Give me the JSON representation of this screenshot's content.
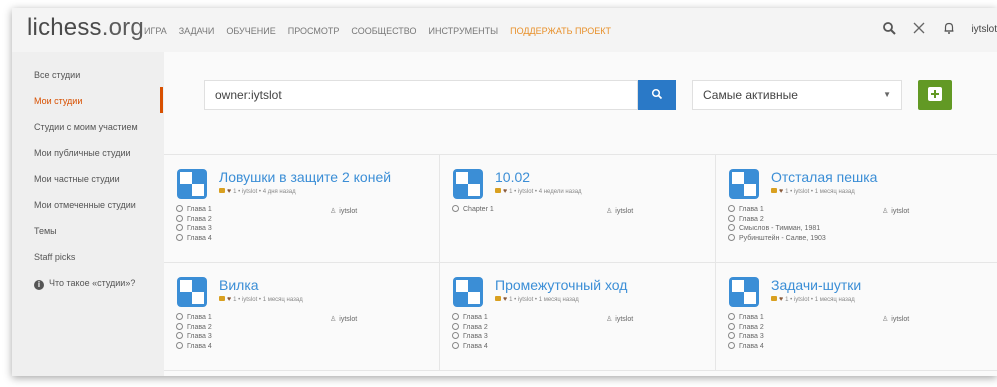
{
  "header": {
    "logo": "lichess",
    "logo_tld": ".org",
    "nav": [
      {
        "label": "ИГРА",
        "accent": false
      },
      {
        "label": "ЗАДАЧИ",
        "accent": false
      },
      {
        "label": "ОБУЧЕНИЕ",
        "accent": false
      },
      {
        "label": "ПРОСМОТР",
        "accent": false
      },
      {
        "label": "СООБЩЕСТВО",
        "accent": false
      },
      {
        "label": "ИНСТРУМЕНТЫ",
        "accent": false
      },
      {
        "label": "ПОДДЕРЖАТЬ ПРОЕКТ",
        "accent": true
      }
    ],
    "username": "iytslot",
    "icons": [
      "search-icon",
      "swords-icon",
      "bell-icon"
    ]
  },
  "sidebar": {
    "items": [
      {
        "label": "Все студии",
        "active": false
      },
      {
        "label": "Мои студии",
        "active": true
      },
      {
        "label": "Студии с моим участием",
        "active": false
      },
      {
        "label": "Мои публичные студии",
        "active": false
      },
      {
        "label": "Мои частные студии",
        "active": false
      },
      {
        "label": "Мои отмеченные студии",
        "active": false
      },
      {
        "label": "Темы",
        "active": false
      },
      {
        "label": "Staff picks",
        "active": false
      }
    ],
    "help": "Что такое «студии»?"
  },
  "toolbar": {
    "search_value": "owner:iytslot",
    "sort_selected": "Самые активные"
  },
  "studies": [
    {
      "title": "Ловушки в защите 2 коней",
      "meta": "1 • iytslot • 4 дня назад",
      "chapters": [
        "Глава 1",
        "Глава 2",
        "Глава 3",
        "Глава 4"
      ],
      "member": "iytslot"
    },
    {
      "title": "10.02",
      "meta": "1 • iytslot • 4 недели назад",
      "chapters": [
        "Chapter 1"
      ],
      "member": "iytslot"
    },
    {
      "title": "Отсталая пешка",
      "meta": "1 • iytslot • 1 месяц назад",
      "chapters": [
        "Глава 1",
        "Глава 2",
        "Смыслов - Тимман, 1981",
        "Рубинштейн - Салве, 1903"
      ],
      "member": "iytslot"
    },
    {
      "title": "Вилка",
      "meta": "1 • iytslot • 1 месяц назад",
      "chapters": [
        "Глава 1",
        "Глава 2",
        "Глава 3",
        "Глава 4"
      ],
      "member": "iytslot"
    },
    {
      "title": "Промежуточный ход",
      "meta": "1 • iytslot • 1 месяц назад",
      "chapters": [
        "Глава 1",
        "Глава 2",
        "Глава 3",
        "Глава 4"
      ],
      "member": "iytslot"
    },
    {
      "title": "Задачи-шутки",
      "meta": "1 • iytslot • 1 месяц назад",
      "chapters": [
        "Глава 1",
        "Глава 2",
        "Глава 3",
        "Глава 4"
      ],
      "member": "iytslot"
    }
  ],
  "colors": {
    "accent_orange": "#d85000",
    "link_blue": "#3b8ed6",
    "search_button": "#2a79c7",
    "add_button": "#629924"
  }
}
